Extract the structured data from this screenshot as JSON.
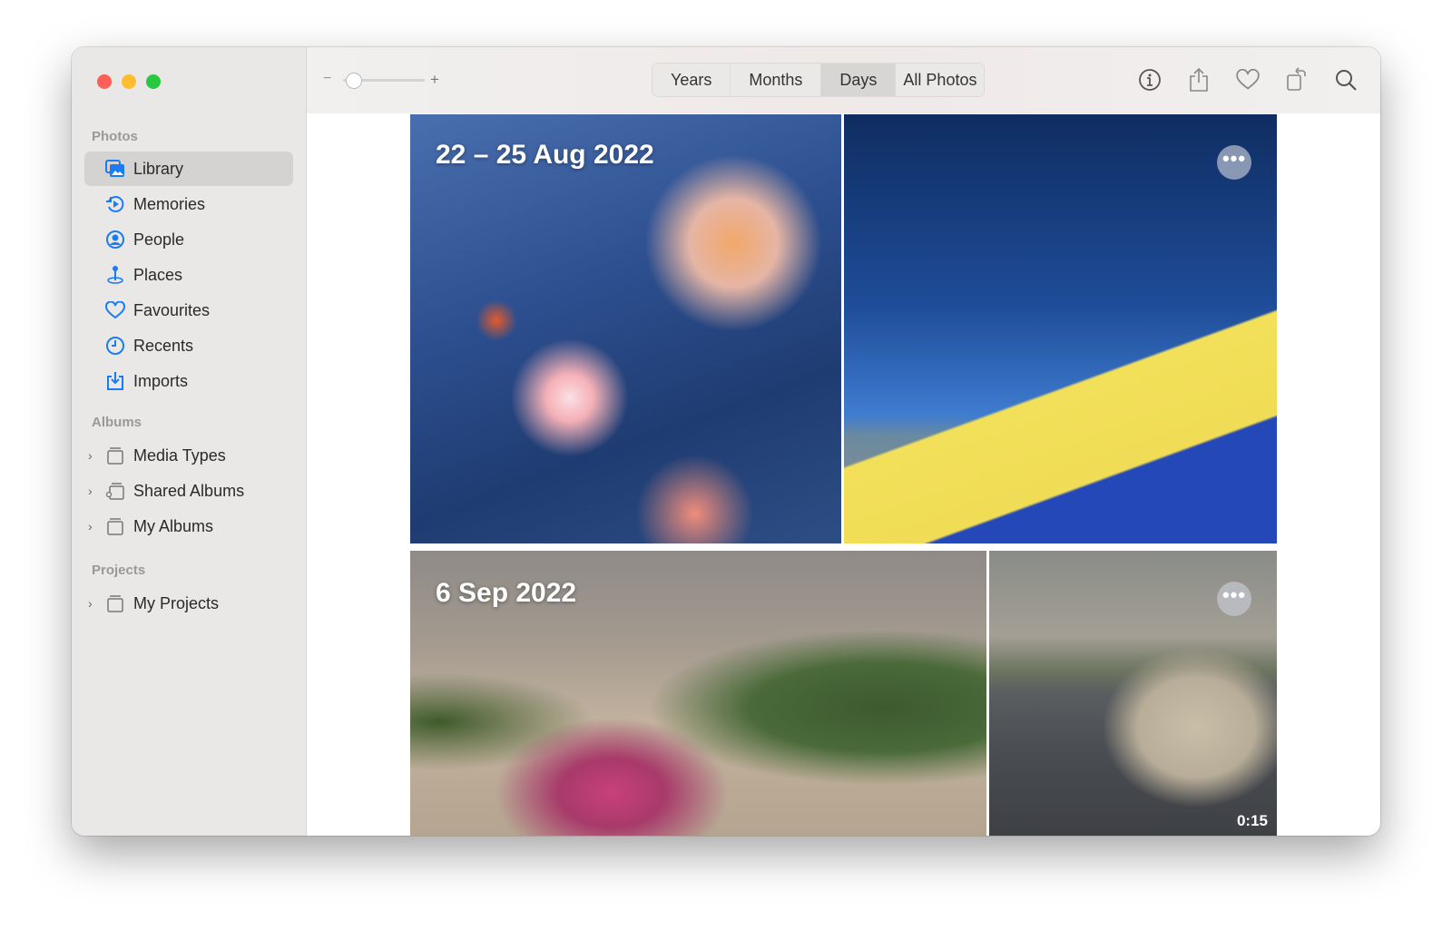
{
  "window": {
    "traffic_lights": {
      "close": "#fe5f57",
      "minimize": "#febc2e",
      "zoom": "#28c840"
    }
  },
  "sidebar": {
    "sections": [
      {
        "label": "Photos",
        "items": [
          {
            "label": "Library",
            "icon": "library-icon",
            "selected": true
          },
          {
            "label": "Memories",
            "icon": "memories-icon"
          },
          {
            "label": "People",
            "icon": "people-icon"
          },
          {
            "label": "Places",
            "icon": "places-icon"
          },
          {
            "label": "Favourites",
            "icon": "heart-icon"
          },
          {
            "label": "Recents",
            "icon": "clock-icon"
          },
          {
            "label": "Imports",
            "icon": "import-icon"
          }
        ]
      },
      {
        "label": "Albums",
        "items": [
          {
            "label": "Media Types",
            "icon": "album-stack-icon"
          },
          {
            "label": "Shared Albums",
            "icon": "shared-album-icon"
          },
          {
            "label": "My Albums",
            "icon": "album-stack-icon"
          }
        ]
      },
      {
        "label": "Projects",
        "items": [
          {
            "label": "My Projects",
            "icon": "album-stack-icon"
          }
        ]
      }
    ]
  },
  "toolbar": {
    "zoom_minus": "−",
    "zoom_plus": "+",
    "zoom_level": 0.1,
    "views": [
      {
        "label": "Years"
      },
      {
        "label": "Months"
      },
      {
        "label": "Days",
        "selected": true
      },
      {
        "label": "All Photos"
      }
    ],
    "tools": [
      "info-icon",
      "share-icon",
      "heart-icon",
      "rotate-icon",
      "search-icon"
    ]
  },
  "groups": [
    {
      "title": "22 – 25 Aug 2022",
      "more": "•••"
    },
    {
      "title": "6 Sep 2022",
      "more": "•••",
      "duration": "0:15"
    }
  ],
  "accent": "#1a7cf5"
}
